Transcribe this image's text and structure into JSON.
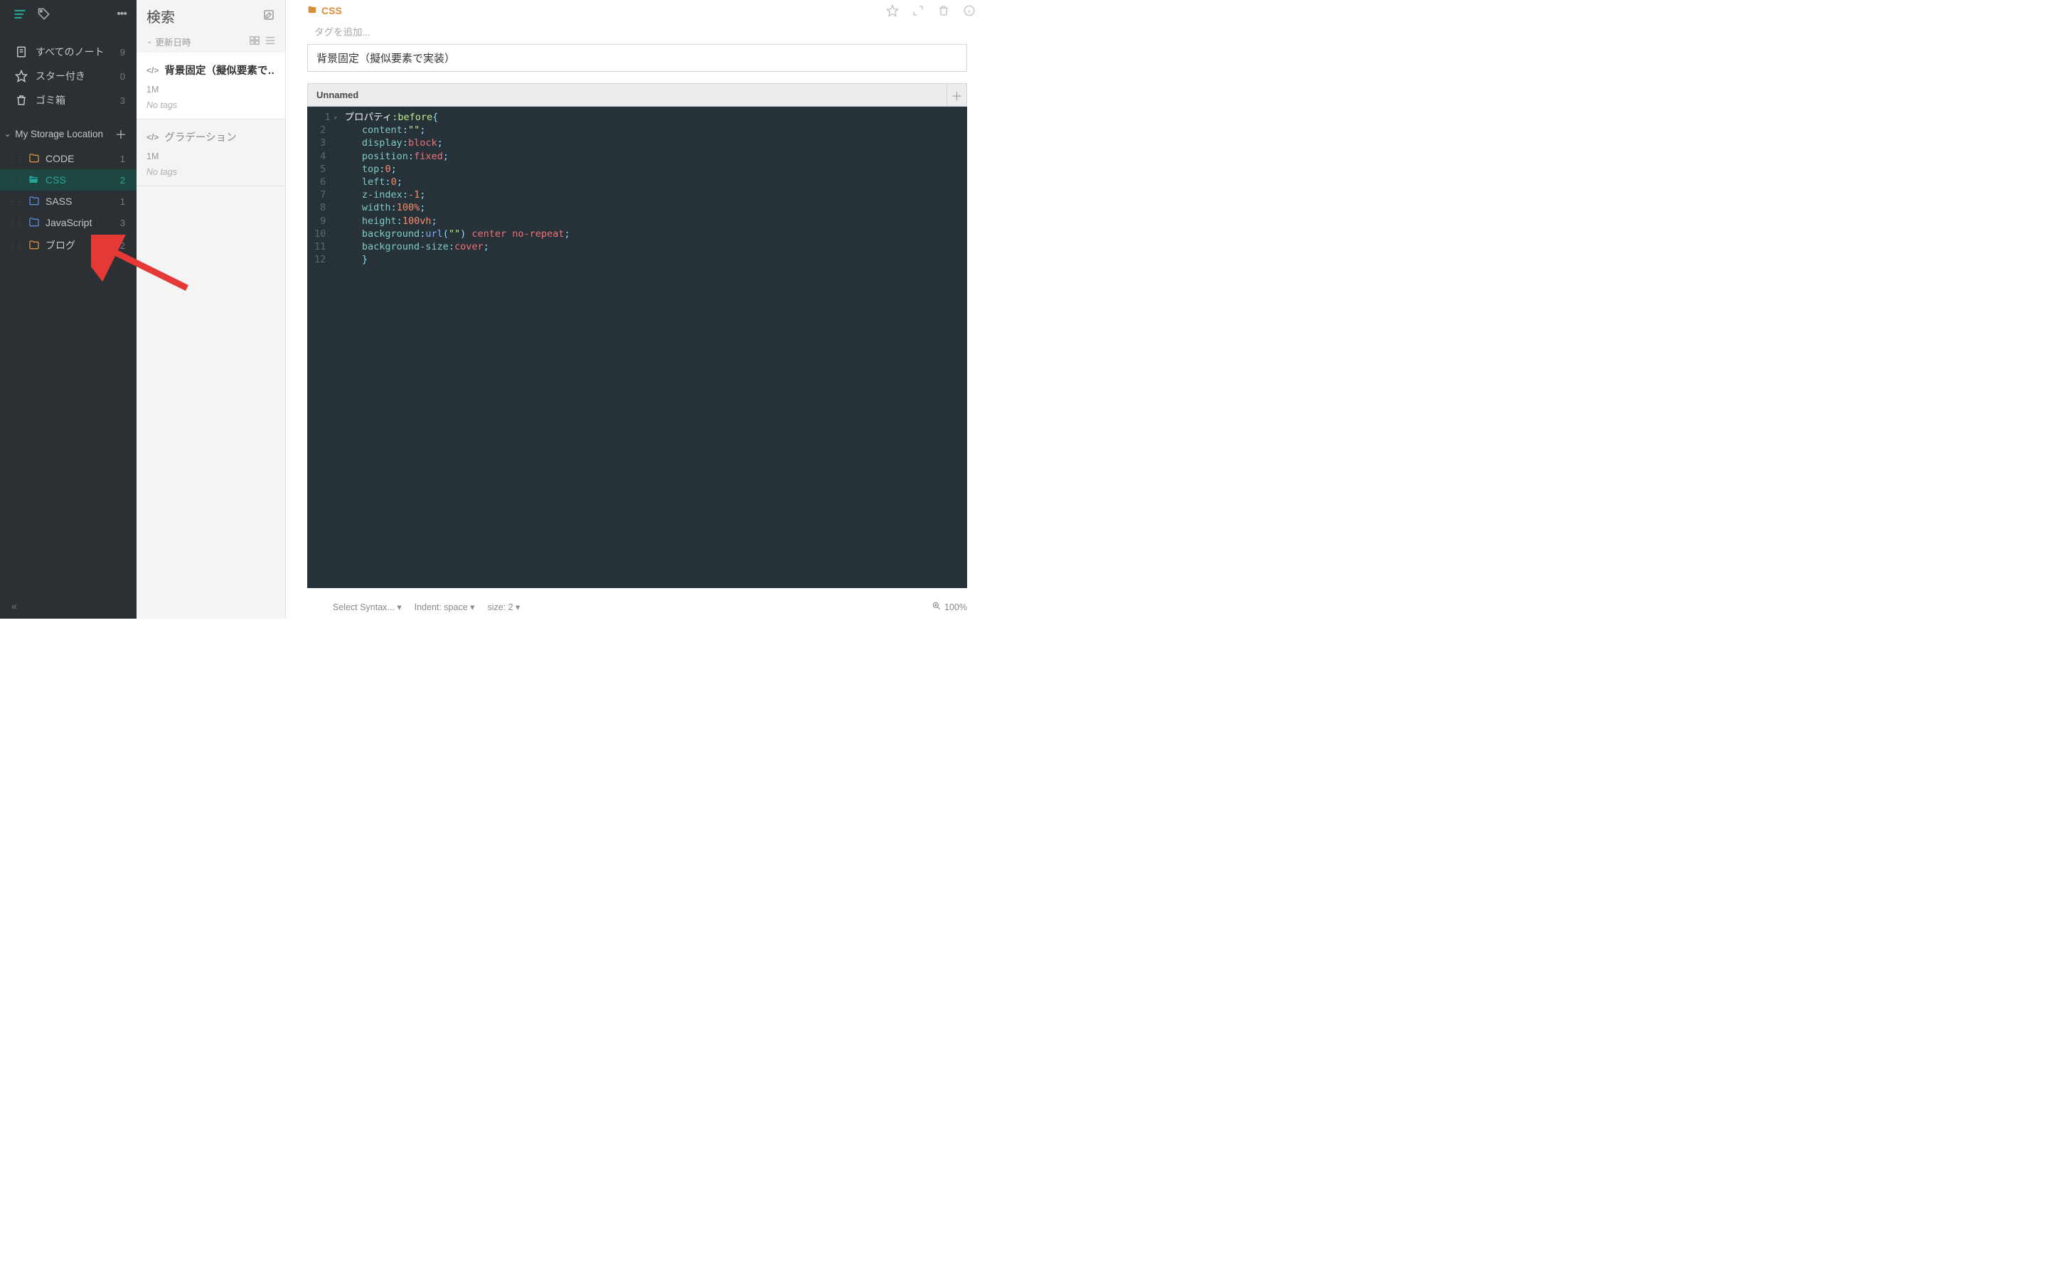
{
  "sidebar": {
    "nav": [
      {
        "icon": "note",
        "label": "すべてのノート",
        "count": "9"
      },
      {
        "icon": "star",
        "label": "スター付き",
        "count": "0"
      },
      {
        "icon": "trash",
        "label": "ゴミ箱",
        "count": "3"
      }
    ],
    "storage_label": "My Storage Location",
    "folders": [
      {
        "name": "CODE",
        "count": "1",
        "color": "orange"
      },
      {
        "name": "CSS",
        "count": "2",
        "color": "teal"
      },
      {
        "name": "SASS",
        "count": "1",
        "color": "blue"
      },
      {
        "name": "JavaScript",
        "count": "3",
        "color": "blue"
      },
      {
        "name": "ブログ",
        "count": "2",
        "color": "orange"
      }
    ]
  },
  "notelist": {
    "search_label": "検索",
    "sort_label": "更新日時",
    "notes": [
      {
        "title": "背景固定（擬似要素で…",
        "time": "1M",
        "tags": "No tags",
        "active": true
      },
      {
        "title": "グラデーション",
        "time": "1M",
        "tags": "No tags",
        "active": false
      }
    ]
  },
  "main": {
    "breadcrumb_folder": "CSS",
    "tag_placeholder": "タグを追加...",
    "title": "背景固定（擬似要素で実装）",
    "snippet_tab": "Unnamed",
    "code_lines": [
      [
        {
          "t": "プロパティ",
          "c": "tok-prop"
        },
        {
          "t": ":before",
          "c": "tok-pseudo"
        },
        {
          "t": "{",
          "c": "tok-punc"
        }
      ],
      [
        {
          "t": "   content",
          "c": "tok-key"
        },
        {
          "t": ":",
          "c": "tok-punc"
        },
        {
          "t": "\"\"",
          "c": "tok-str"
        },
        {
          "t": ";",
          "c": "tok-punc"
        }
      ],
      [
        {
          "t": "   display",
          "c": "tok-key"
        },
        {
          "t": ":",
          "c": "tok-punc"
        },
        {
          "t": "block",
          "c": "tok-val"
        },
        {
          "t": ";",
          "c": "tok-punc"
        }
      ],
      [
        {
          "t": "   position",
          "c": "tok-key"
        },
        {
          "t": ":",
          "c": "tok-punc"
        },
        {
          "t": "fixed",
          "c": "tok-val"
        },
        {
          "t": ";",
          "c": "tok-punc"
        }
      ],
      [
        {
          "t": "   top",
          "c": "tok-key"
        },
        {
          "t": ":",
          "c": "tok-punc"
        },
        {
          "t": "0",
          "c": "tok-num"
        },
        {
          "t": ";",
          "c": "tok-punc"
        }
      ],
      [
        {
          "t": "   left",
          "c": "tok-key"
        },
        {
          "t": ":",
          "c": "tok-punc"
        },
        {
          "t": "0",
          "c": "tok-num"
        },
        {
          "t": ";",
          "c": "tok-punc"
        }
      ],
      [
        {
          "t": "   z-index",
          "c": "tok-key"
        },
        {
          "t": ":",
          "c": "tok-punc"
        },
        {
          "t": "-1",
          "c": "tok-num"
        },
        {
          "t": ";",
          "c": "tok-punc"
        }
      ],
      [
        {
          "t": "   width",
          "c": "tok-key"
        },
        {
          "t": ":",
          "c": "tok-punc"
        },
        {
          "t": "100%",
          "c": "tok-num"
        },
        {
          "t": ";",
          "c": "tok-punc"
        }
      ],
      [
        {
          "t": "   height",
          "c": "tok-key"
        },
        {
          "t": ":",
          "c": "tok-punc"
        },
        {
          "t": "100vh",
          "c": "tok-num"
        },
        {
          "t": ";",
          "c": "tok-punc"
        }
      ],
      [
        {
          "t": "   background",
          "c": "tok-key"
        },
        {
          "t": ":",
          "c": "tok-punc"
        },
        {
          "t": "url",
          "c": "tok-fn"
        },
        {
          "t": "(",
          "c": "tok-punc"
        },
        {
          "t": "\"\"",
          "c": "tok-str"
        },
        {
          "t": ")",
          "c": "tok-punc"
        },
        {
          "t": " center no-repeat",
          "c": "tok-val"
        },
        {
          "t": ";",
          "c": "tok-punc"
        }
      ],
      [
        {
          "t": "   background-size",
          "c": "tok-key"
        },
        {
          "t": ":",
          "c": "tok-punc"
        },
        {
          "t": "cover",
          "c": "tok-val"
        },
        {
          "t": ";",
          "c": "tok-punc"
        }
      ],
      [
        {
          "t": "   }",
          "c": "tok-punc"
        }
      ]
    ],
    "status": {
      "syntax": "Select Syntax...",
      "indent": "Indent: space",
      "size": "size: 2",
      "zoom": "100%"
    }
  }
}
